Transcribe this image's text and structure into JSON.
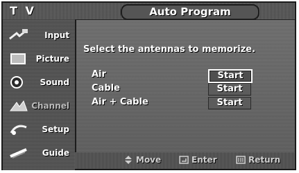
{
  "header": {
    "tv_label": "T V",
    "title": "Auto Program"
  },
  "sidebar": {
    "items": [
      {
        "label": "Input",
        "icon": "input-plug-icon",
        "active": false
      },
      {
        "label": "Picture",
        "icon": "picture-icon",
        "active": false
      },
      {
        "label": "Sound",
        "icon": "sound-icon",
        "active": false
      },
      {
        "label": "Channel",
        "icon": "channel-icon",
        "active": true
      },
      {
        "label": "Setup",
        "icon": "setup-icon",
        "active": false
      },
      {
        "label": "Guide",
        "icon": "guide-icon",
        "active": false
      }
    ]
  },
  "main": {
    "instruction": "Select the antennas to memorize.",
    "options": [
      {
        "name": "Air",
        "button": "Start",
        "selected": true
      },
      {
        "name": "Cable",
        "button": "Start",
        "selected": false
      },
      {
        "name": "Air + Cable",
        "button": "Start",
        "selected": false
      }
    ]
  },
  "footer": {
    "hints": [
      {
        "icon": "updown-arrows-icon",
        "label": "Move"
      },
      {
        "icon": "enter-icon",
        "label": "Enter"
      },
      {
        "icon": "return-icon",
        "label": "Return"
      }
    ]
  },
  "colors": {
    "panel": "#5a5a5a",
    "sidebar": "#4d4d4d",
    "text": "#ffffff",
    "hint_text": "#cfcfcf"
  }
}
